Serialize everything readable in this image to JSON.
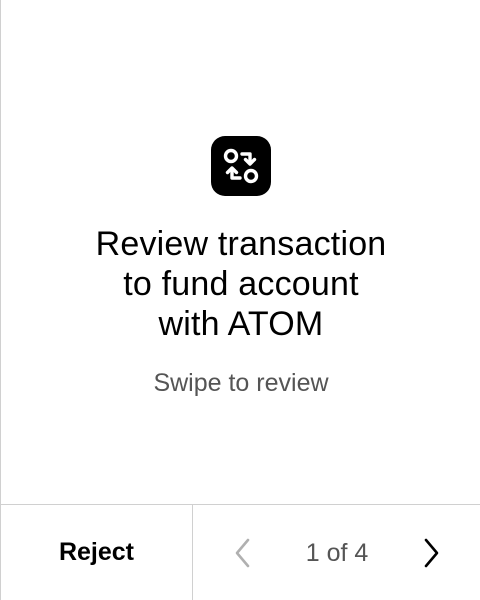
{
  "colors": {
    "text": "#000000",
    "muted": "#555555",
    "divider": "#d0d0d0",
    "disabled": "#b0b0b0",
    "background": "#ffffff"
  },
  "main": {
    "icon": "transaction-swap-icon",
    "title_lines": [
      "Review transaction",
      "to fund account",
      "with ATOM"
    ],
    "subtitle": "Swipe to review"
  },
  "footer": {
    "reject_label": "Reject",
    "page_indicator": "1 of 4",
    "prev_icon": "chevron-left-icon",
    "next_icon": "chevron-right-icon",
    "prev_disabled": true
  }
}
